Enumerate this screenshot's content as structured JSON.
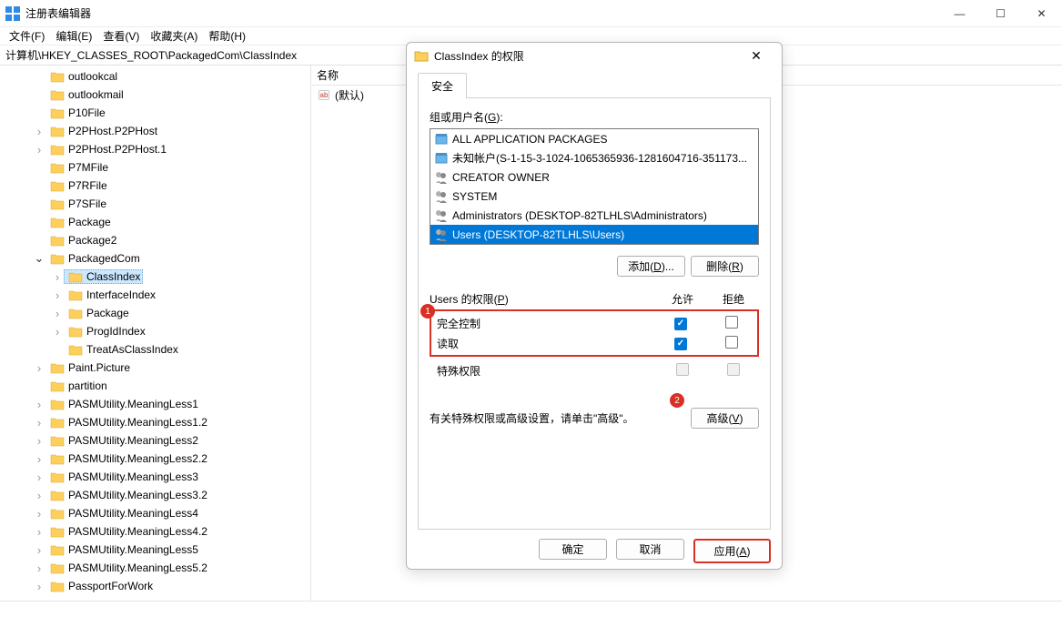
{
  "window": {
    "title": "注册表编辑器"
  },
  "menu": {
    "file": "文件(F)",
    "edit": "编辑(E)",
    "view": "查看(V)",
    "favorites": "收藏夹(A)",
    "help": "帮助(H)"
  },
  "address": "计算机\\HKEY_CLASSES_ROOT\\PackagedCom\\ClassIndex",
  "tree": {
    "items": [
      {
        "label": "outlookcal",
        "indent": 2,
        "expander": ""
      },
      {
        "label": "outlookmail",
        "indent": 2,
        "expander": ""
      },
      {
        "label": "P10File",
        "indent": 2,
        "expander": ""
      },
      {
        "label": "P2PHost.P2PHost",
        "indent": 2,
        "expander": ">"
      },
      {
        "label": "P2PHost.P2PHost.1",
        "indent": 2,
        "expander": ">"
      },
      {
        "label": "P7MFile",
        "indent": 2,
        "expander": ""
      },
      {
        "label": "P7RFile",
        "indent": 2,
        "expander": ""
      },
      {
        "label": "P7SFile",
        "indent": 2,
        "expander": ""
      },
      {
        "label": "Package",
        "indent": 2,
        "expander": ""
      },
      {
        "label": "Package2",
        "indent": 2,
        "expander": ""
      },
      {
        "label": "PackagedCom",
        "indent": 2,
        "expander": "v"
      },
      {
        "label": "ClassIndex",
        "indent": 3,
        "expander": ">",
        "selected": true
      },
      {
        "label": "InterfaceIndex",
        "indent": 3,
        "expander": ">"
      },
      {
        "label": "Package",
        "indent": 3,
        "expander": ">"
      },
      {
        "label": "ProgIdIndex",
        "indent": 3,
        "expander": ">"
      },
      {
        "label": "TreatAsClassIndex",
        "indent": 3,
        "expander": ""
      },
      {
        "label": "Paint.Picture",
        "indent": 2,
        "expander": ">"
      },
      {
        "label": "partition",
        "indent": 2,
        "expander": ""
      },
      {
        "label": "PASMUtility.MeaningLess1",
        "indent": 2,
        "expander": ">"
      },
      {
        "label": "PASMUtility.MeaningLess1.2",
        "indent": 2,
        "expander": ">"
      },
      {
        "label": "PASMUtility.MeaningLess2",
        "indent": 2,
        "expander": ">"
      },
      {
        "label": "PASMUtility.MeaningLess2.2",
        "indent": 2,
        "expander": ">"
      },
      {
        "label": "PASMUtility.MeaningLess3",
        "indent": 2,
        "expander": ">"
      },
      {
        "label": "PASMUtility.MeaningLess3.2",
        "indent": 2,
        "expander": ">"
      },
      {
        "label": "PASMUtility.MeaningLess4",
        "indent": 2,
        "expander": ">"
      },
      {
        "label": "PASMUtility.MeaningLess4.2",
        "indent": 2,
        "expander": ">"
      },
      {
        "label": "PASMUtility.MeaningLess5",
        "indent": 2,
        "expander": ">"
      },
      {
        "label": "PASMUtility.MeaningLess5.2",
        "indent": 2,
        "expander": ">"
      },
      {
        "label": "PassportForWork",
        "indent": 2,
        "expander": ">"
      }
    ]
  },
  "list": {
    "col_name": "名称",
    "default_value": "(默认)"
  },
  "dialog": {
    "title": "ClassIndex 的权限",
    "tab_security": "安全",
    "group_label_prefix": "组或用户名(",
    "group_label_u": "G",
    "group_label_suffix": "):",
    "users": [
      {
        "name": "ALL APPLICATION PACKAGES",
        "icon": "box"
      },
      {
        "name": "未知帐户(S-1-15-3-1024-1065365936-1281604716-351173...",
        "icon": "box"
      },
      {
        "name": "CREATOR OWNER",
        "icon": "group"
      },
      {
        "name": "SYSTEM",
        "icon": "group"
      },
      {
        "name": "Administrators (DESKTOP-82TLHLS\\Administrators)",
        "icon": "group"
      },
      {
        "name": "Users (DESKTOP-82TLHLS\\Users)",
        "icon": "group",
        "selected": true
      }
    ],
    "btn_add_prefix": "添加(",
    "btn_add_u": "D",
    "btn_add_suffix": ")...",
    "btn_remove_prefix": "删除(",
    "btn_remove_u": "R",
    "btn_remove_suffix": ")",
    "perm_label_prefix": "Users 的权限(",
    "perm_label_u": "P",
    "perm_label_suffix": ")",
    "perm_col_allow": "允许",
    "perm_col_deny": "拒绝",
    "perms": [
      {
        "name": "完全控制",
        "allow": true,
        "deny": false
      },
      {
        "name": "读取",
        "allow": true,
        "deny": false
      }
    ],
    "perm_special": {
      "name": "特殊权限",
      "allow": false,
      "deny": false,
      "disabled": true
    },
    "badge1": "1",
    "badge2": "2",
    "adv_text": "有关特殊权限或高级设置，请单击\"高级\"。",
    "btn_adv_prefix": "高级(",
    "btn_adv_u": "V",
    "btn_adv_suffix": ")",
    "btn_ok": "确定",
    "btn_cancel": "取消",
    "btn_apply_prefix": "应用(",
    "btn_apply_u": "A",
    "btn_apply_suffix": ")"
  }
}
